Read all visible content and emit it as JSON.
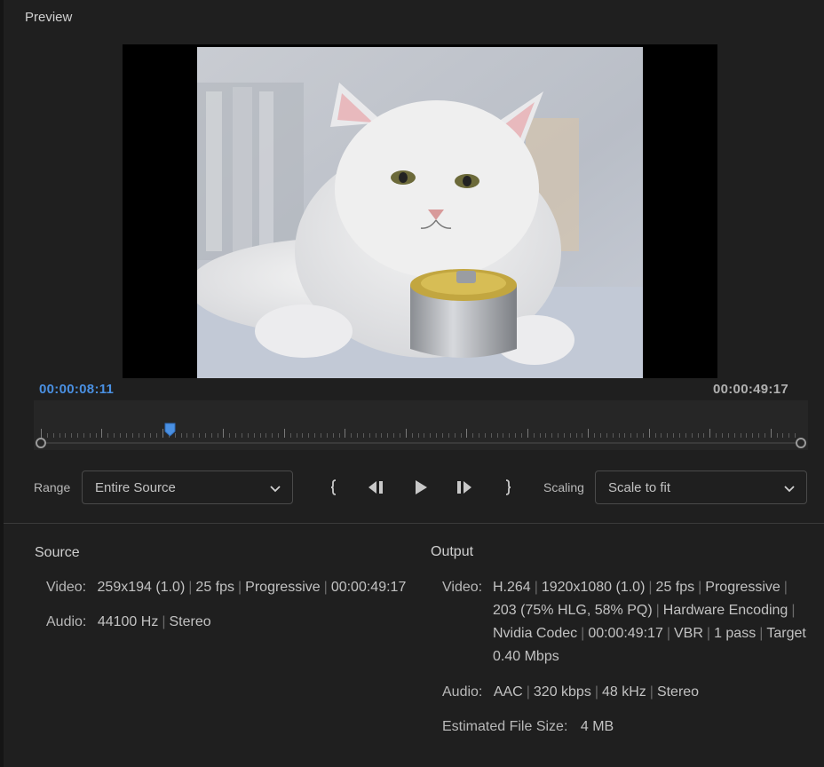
{
  "panel": {
    "title": "Preview"
  },
  "timecode": {
    "current": "00:00:08:11",
    "total": "00:00:49:17"
  },
  "playhead_fraction": 0.17,
  "controls": {
    "range_label": "Range",
    "range_value": "Entire Source",
    "scaling_label": "Scaling",
    "scaling_value": "Scale to fit"
  },
  "source": {
    "title": "Source",
    "video_key": "Video:",
    "video_parts": [
      "259x194 (1.0)",
      "25 fps",
      "Progressive",
      "00:00:49:17"
    ],
    "audio_key": "Audio:",
    "audio_parts": [
      "44100 Hz",
      "Stereo"
    ]
  },
  "output": {
    "title": "Output",
    "video_key": "Video:",
    "video_lines": [
      [
        "H.264",
        "1920x1080 (1.0)",
        "25 fps",
        "Progressive",
        ""
      ],
      [
        "203 (75% HLG, 58% PQ)",
        "Hardware Encoding",
        ""
      ],
      [
        "Nvidia Codec",
        "00:00:49:17",
        "VBR",
        "1 pass",
        "Target"
      ],
      [
        "0.40 Mbps"
      ]
    ],
    "audio_key": "Audio:",
    "audio_parts": [
      "AAC",
      "320 kbps",
      "48 kHz",
      "Stereo"
    ],
    "filesize_key": "Estimated File Size:",
    "filesize_value": "4 MB"
  },
  "colors": {
    "accent": "#4a90e2",
    "background": "#1f1f1f",
    "border": "#4a4a4a"
  }
}
